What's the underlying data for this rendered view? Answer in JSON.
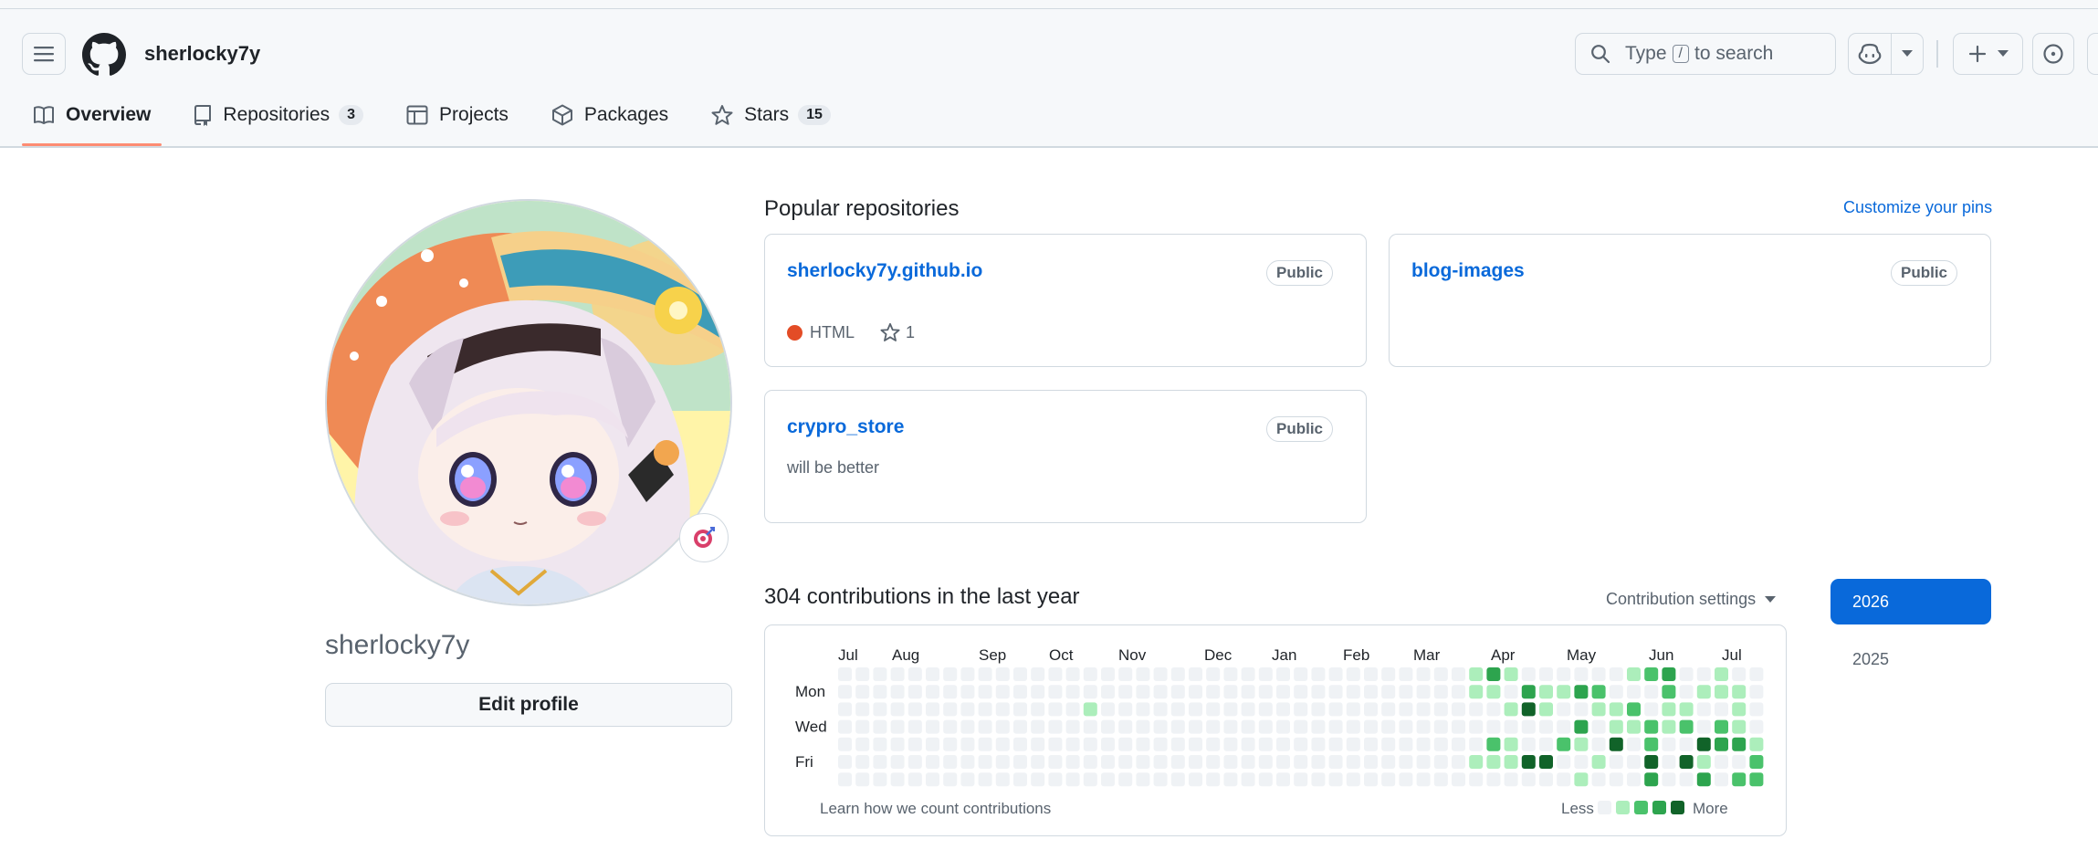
{
  "header": {
    "username": "sherlocky7y",
    "search_prefix": "Type",
    "search_key": "/",
    "search_suffix": "to search"
  },
  "tabs": [
    {
      "label": "Overview",
      "icon": "book-icon",
      "active": true
    },
    {
      "label": "Repositories",
      "icon": "repo-icon",
      "count": "3"
    },
    {
      "label": "Projects",
      "icon": "table-icon"
    },
    {
      "label": "Packages",
      "icon": "package-icon"
    },
    {
      "label": "Stars",
      "icon": "star-icon",
      "count": "15"
    }
  ],
  "profile": {
    "name": "sherlocky7y",
    "edit_label": "Edit profile"
  },
  "popular": {
    "title": "Popular repositories",
    "customize": "Customize your pins",
    "repos": [
      {
        "name": "sherlocky7y.github.io",
        "visibility": "Public",
        "language": "HTML",
        "language_color": "#e34c26",
        "stars": "1"
      },
      {
        "name": "blog-images",
        "visibility": "Public"
      },
      {
        "name": "crypro_store",
        "visibility": "Public",
        "description": "will be better"
      }
    ]
  },
  "contributions": {
    "title": "304 contributions in the last year",
    "settings": "Contribution settings",
    "months": [
      "Jul",
      "Aug",
      "Sep",
      "Oct",
      "Nov",
      "Dec",
      "Jan",
      "Feb",
      "Mar",
      "Apr",
      "May",
      "Jun",
      "Jul"
    ],
    "days": [
      "Mon",
      "Wed",
      "Fri"
    ],
    "learn": "Learn how we count contributions",
    "less": "Less",
    "more": "More",
    "levels": [
      "#eff2f5",
      "#aceebb",
      "#4ac26b",
      "#2da44e",
      "#116329"
    ],
    "years": [
      "2026",
      "2025"
    ]
  }
}
